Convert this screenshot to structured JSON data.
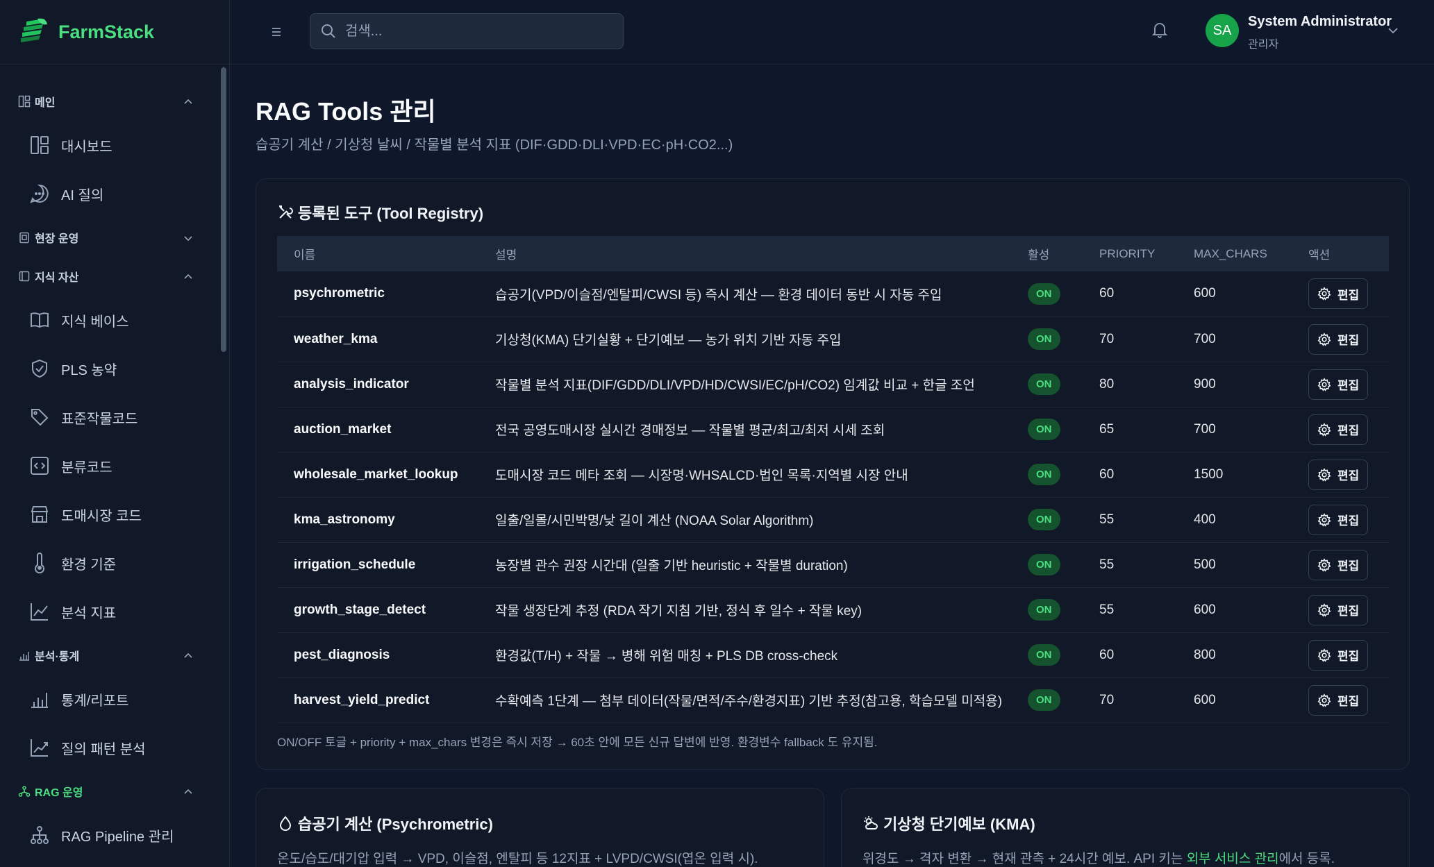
{
  "brand": {
    "name": "FarmStack"
  },
  "header": {
    "search_placeholder": "검색...",
    "user_initials": "SA",
    "user_name": "System Administrator",
    "user_role": "관리자"
  },
  "sidebar": {
    "sections": [
      {
        "label": "메인",
        "items": [
          "대시보드",
          "AI 질의"
        ]
      },
      {
        "label": "현장 운영",
        "items": []
      },
      {
        "label": "지식 자산",
        "items": [
          "지식 베이스",
          "PLS 농약",
          "표준작물코드",
          "분류코드",
          "도매시장 코드",
          "환경 기준",
          "분석 지표"
        ]
      },
      {
        "label": "분석·통계",
        "items": [
          "통계/리포트",
          "질의 패턴 분석"
        ]
      },
      {
        "label": "RAG 운영",
        "items": [
          "RAG Pipeline 관리"
        ]
      }
    ]
  },
  "page": {
    "title": "RAG Tools 관리",
    "subtitle": "습공기 계산 / 기상청 날씨 / 작물별 분석 지표 (DIF·GDD·DLI·VPD·EC·pH·CO2...)"
  },
  "registry": {
    "title": "등록된 도구 (Tool Registry)",
    "columns": [
      "이름",
      "설명",
      "활성",
      "PRIORITY",
      "MAX_CHARS",
      "액션"
    ],
    "edit_label": "편집",
    "rows": [
      {
        "name": "psychrometric",
        "desc": "습공기(VPD/이슬점/엔탈피/CWSI 등) 즉시 계산 — 환경 데이터 동반 시 자동 주입",
        "active": "ON",
        "priority": "60",
        "max_chars": "600"
      },
      {
        "name": "weather_kma",
        "desc": "기상청(KMA) 단기실황 + 단기예보 — 농가 위치 기반 자동 주입",
        "active": "ON",
        "priority": "70",
        "max_chars": "700"
      },
      {
        "name": "analysis_indicator",
        "desc": "작물별 분석 지표(DIF/GDD/DLI/VPD/HD/CWSI/EC/pH/CO2) 임계값 비교 + 한글 조언",
        "active": "ON",
        "priority": "80",
        "max_chars": "900"
      },
      {
        "name": "auction_market",
        "desc": "전국 공영도매시장 실시간 경매정보 — 작물별 평균/최고/최저 시세 조회",
        "active": "ON",
        "priority": "65",
        "max_chars": "700"
      },
      {
        "name": "wholesale_market_lookup",
        "desc": "도매시장 코드 메타 조회 — 시장명·WHSALCD·법인 목록·지역별 시장 안내",
        "active": "ON",
        "priority": "60",
        "max_chars": "1500"
      },
      {
        "name": "kma_astronomy",
        "desc": "일출/일몰/시민박명/낮 길이 계산 (NOAA Solar Algorithm)",
        "active": "ON",
        "priority": "55",
        "max_chars": "400"
      },
      {
        "name": "irrigation_schedule",
        "desc": "농장별 관수 권장 시간대 (일출 기반 heuristic + 작물별 duration)",
        "active": "ON",
        "priority": "55",
        "max_chars": "500"
      },
      {
        "name": "growth_stage_detect",
        "desc": "작물 생장단계 추정 (RDA 작기 지침 기반, 정식 후 일수 + 작물 key)",
        "active": "ON",
        "priority": "55",
        "max_chars": "600"
      },
      {
        "name": "pest_diagnosis",
        "desc": "환경값(T/H) + 작물 → 병해 위험 매칭 + PLS DB cross-check",
        "active": "ON",
        "priority": "60",
        "max_chars": "800"
      },
      {
        "name": "harvest_yield_predict",
        "desc": "수확예측 1단계 — 첨부 데이터(작물/면적/주수/환경지표) 기반 추정(참고용, 학습모델 미적용)",
        "active": "ON",
        "priority": "70",
        "max_chars": "600"
      }
    ],
    "footnote": "ON/OFF 토글 + priority + max_chars 변경은 즉시 저장 → 60초 안에 모든 신규 답변에 반영. 환경변수 fallback 도 유지됨."
  },
  "psychro_card": {
    "title": "습공기 계산 (Psychrometric)",
    "desc": "온도/습도/대기압 입력 → VPD, 이슬점, 엔탈피 등 12지표 + LVPD/CWSI(엽온 입력 시)."
  },
  "kma_card": {
    "title": "기상청 단기예보 (KMA)",
    "desc_pre": "위경도 → 격자 변환 → 현재 관측 + 24시간 예보. API 키는 ",
    "desc_link": "외부 서비스 관리",
    "desc_post": "에서 등록."
  }
}
